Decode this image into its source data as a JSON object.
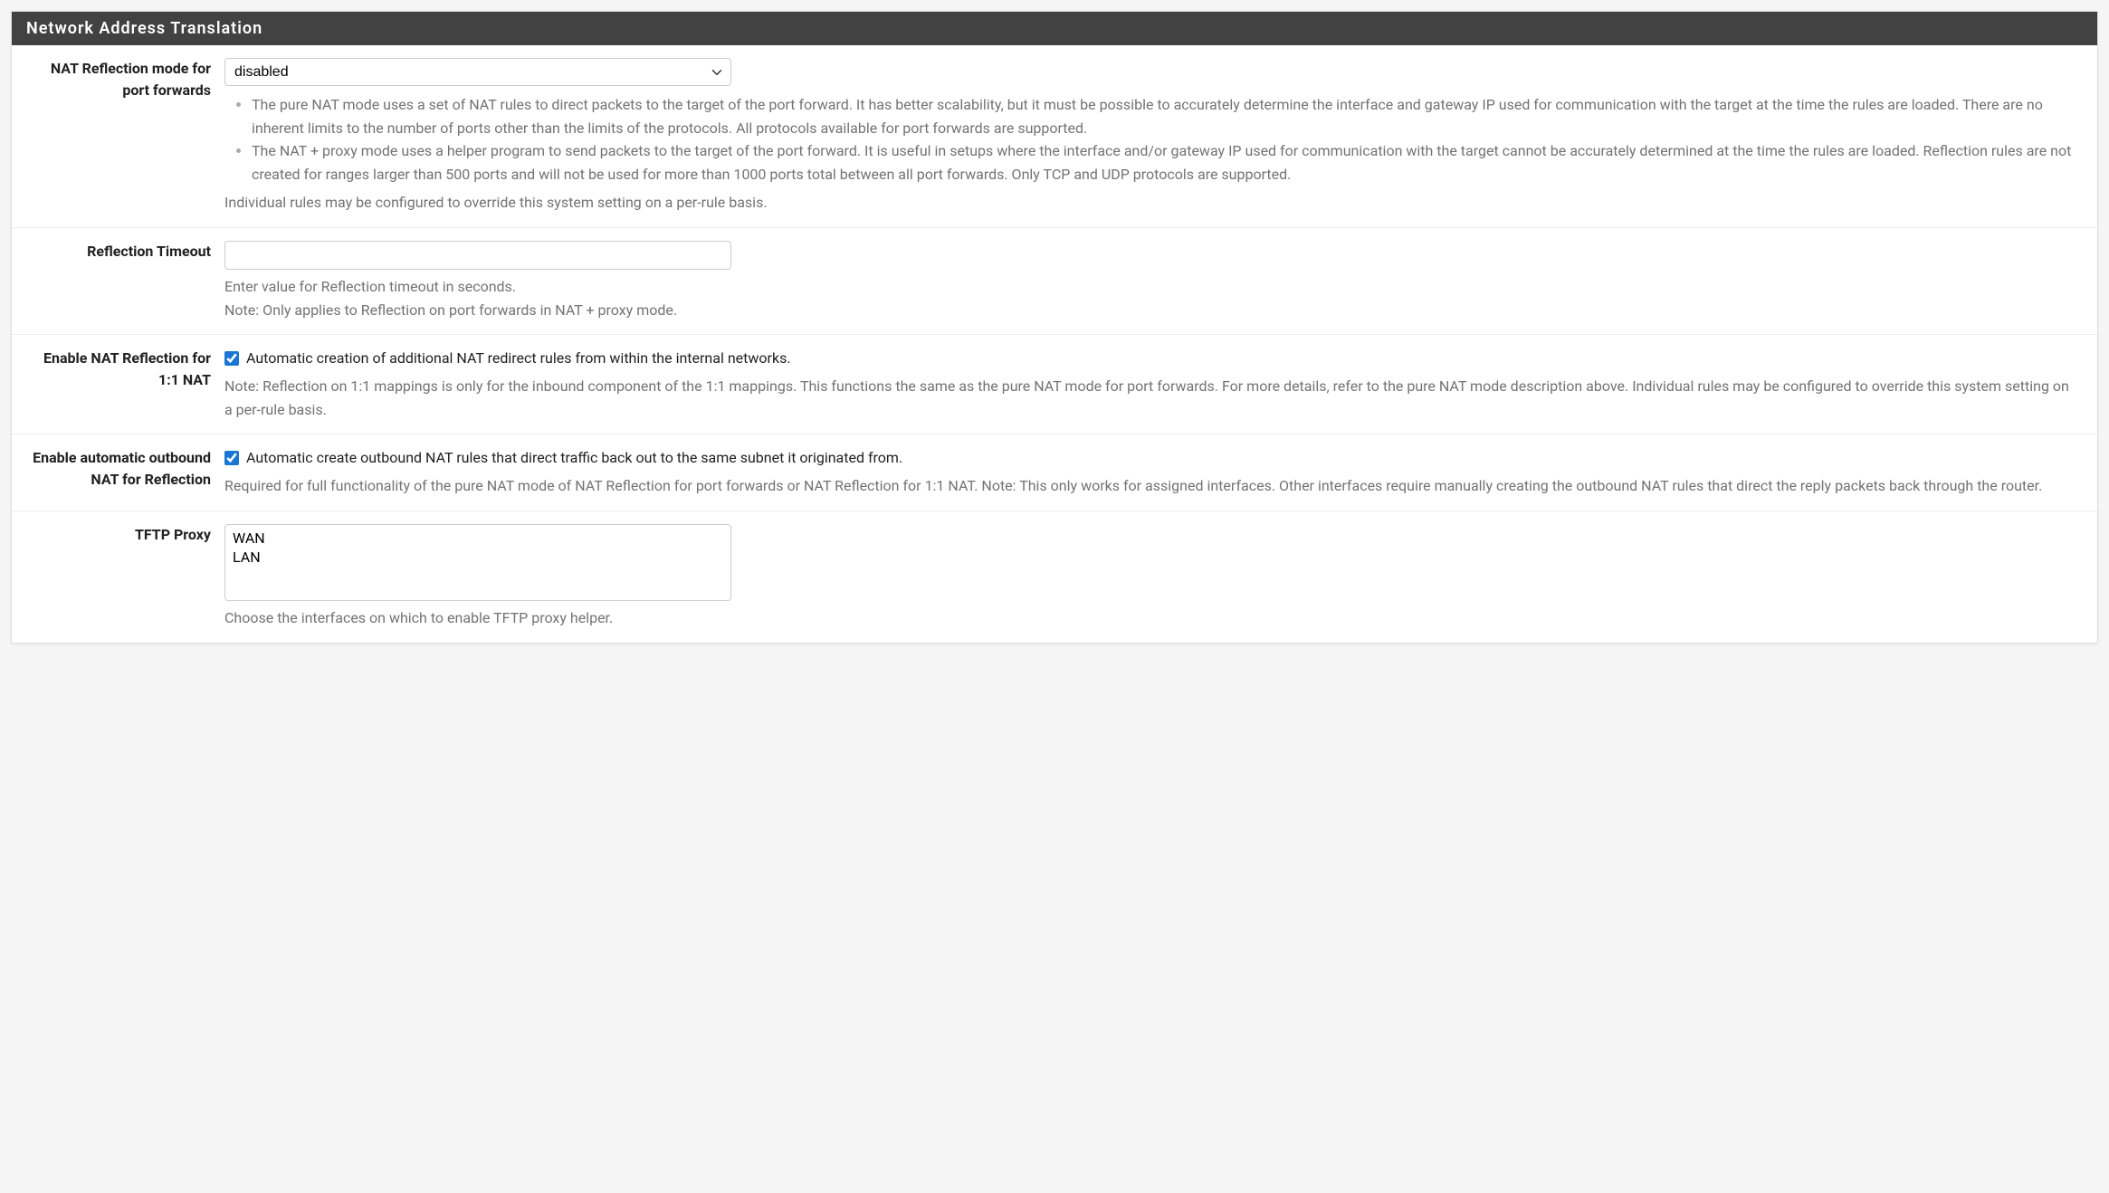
{
  "panel": {
    "title": "Network Address Translation"
  },
  "nat_reflection_mode": {
    "label": "NAT Reflection mode for port forwards",
    "selected": "disabled",
    "bullet1": "The pure NAT mode uses a set of NAT rules to direct packets to the target of the port forward. It has better scalability, but it must be possible to accurately determine the interface and gateway IP used for communication with the target at the time the rules are loaded. There are no inherent limits to the number of ports other than the limits of the protocols. All protocols available for port forwards are supported.",
    "bullet2": "The NAT + proxy mode uses a helper program to send packets to the target of the port forward. It is useful in setups where the interface and/or gateway IP used for communication with the target cannot be accurately determined at the time the rules are loaded. Reflection rules are not created for ranges larger than 500 ports and will not be used for more than 1000 ports total between all port forwards. Only TCP and UDP protocols are supported.",
    "help_footer": "Individual rules may be configured to override this system setting on a per-rule basis."
  },
  "reflection_timeout": {
    "label": "Reflection Timeout",
    "value": "",
    "help1": "Enter value for Reflection timeout in seconds.",
    "help2": "Note: Only applies to Reflection on port forwards in NAT + proxy mode."
  },
  "enable_1to1": {
    "label": "Enable NAT Reflection for 1:1 NAT",
    "checked": true,
    "checkbox_label": "Automatic creation of additional NAT redirect rules from within the internal networks.",
    "help": "Note: Reflection on 1:1 mappings is only for the inbound component of the 1:1 mappings. This functions the same as the pure NAT mode for port forwards. For more details, refer to the pure NAT mode description above. Individual rules may be configured to override this system setting on a per-rule basis."
  },
  "enable_outbound": {
    "label": "Enable automatic outbound NAT for Reflection",
    "checked": true,
    "checkbox_label": "Automatic create outbound NAT rules that direct traffic back out to the same subnet it originated from.",
    "help": "Required for full functionality of the pure NAT mode of NAT Reflection for port forwards or NAT Reflection for 1:1 NAT. Note: This only works for assigned interfaces. Other interfaces require manually creating the outbound NAT rules that direct the reply packets back through the router."
  },
  "tftp_proxy": {
    "label": "TFTP Proxy",
    "options": [
      "WAN",
      "LAN"
    ],
    "help": "Choose the interfaces on which to enable TFTP proxy helper."
  }
}
